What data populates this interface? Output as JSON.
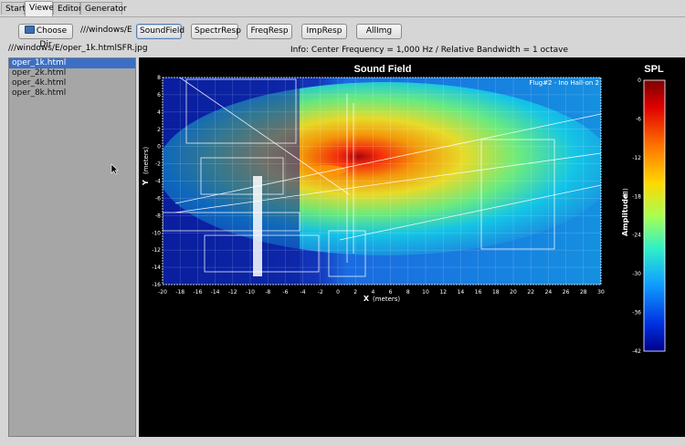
{
  "tabs": [
    {
      "label": "Start",
      "active": false
    },
    {
      "label": "Viewer",
      "active": true
    },
    {
      "label": "Editor",
      "active": false
    },
    {
      "label": "Generator",
      "active": false
    }
  ],
  "toolbar": {
    "choose_dir_label": "Choose Dir",
    "dir_path": "///windows/E",
    "buttons": [
      "SoundField",
      "SpectrResp",
      "FreqResp",
      "ImpResp",
      "AllImg"
    ],
    "selected_button": "SoundField",
    "current_file_path": "///windows/E/oper_1k.htmlSFR.jpg",
    "info_text": "Info: Center Frequency = 1,000 Hz / Relative Bandwidth = 1 octave"
  },
  "file_list": {
    "items": [
      "oper_1k.html",
      "oper_2k.html",
      "oper_4k.html",
      "oper_8k.html"
    ],
    "selected_index": 0
  },
  "plot": {
    "title": "Sound Field",
    "xlabel": "X",
    "xunit": "(meters)",
    "ylabel": "Y",
    "yunit": "(meters)",
    "x_ticks": [
      "-20",
      "-18",
      "-16",
      "-14",
      "-12",
      "-10",
      "-8",
      "-6",
      "-4",
      "-2",
      "0",
      "2",
      "4",
      "6",
      "8",
      "10",
      "12",
      "14",
      "16",
      "18",
      "20",
      "22",
      "24",
      "26",
      "28",
      "30"
    ],
    "y_ticks": [
      "8",
      "6",
      "4",
      "2",
      "0",
      "-2",
      "-4",
      "-6",
      "-8",
      "-10",
      "-12",
      "-14",
      "-16"
    ],
    "corner_label": "Flug#2 - Ino Hall-on 2",
    "colorbar_title": "SPL",
    "colorbar_label": "Amplitude",
    "colorbar_unit": "(dB)",
    "colorbar_ticks": [
      "0",
      "-6",
      "-12",
      "-18",
      "-24",
      "-30",
      "-36",
      "-42"
    ]
  },
  "chart_data": {
    "type": "heatmap",
    "title": "Sound Field",
    "xlabel": "X (meters)",
    "ylabel": "Y (meters)",
    "xlim": [
      -20,
      30
    ],
    "ylim": [
      -16,
      8
    ],
    "colorbar": {
      "label": "Amplitude (dB)",
      "range": [
        -42,
        0
      ],
      "title": "SPL"
    },
    "hotspot_source_xy": [
      2,
      2
    ]
  },
  "colors": {
    "selection": "#3b6fc6",
    "viewer_bg": "#000000",
    "field_low": "#0a1f9e",
    "field_high": "#d40000"
  }
}
